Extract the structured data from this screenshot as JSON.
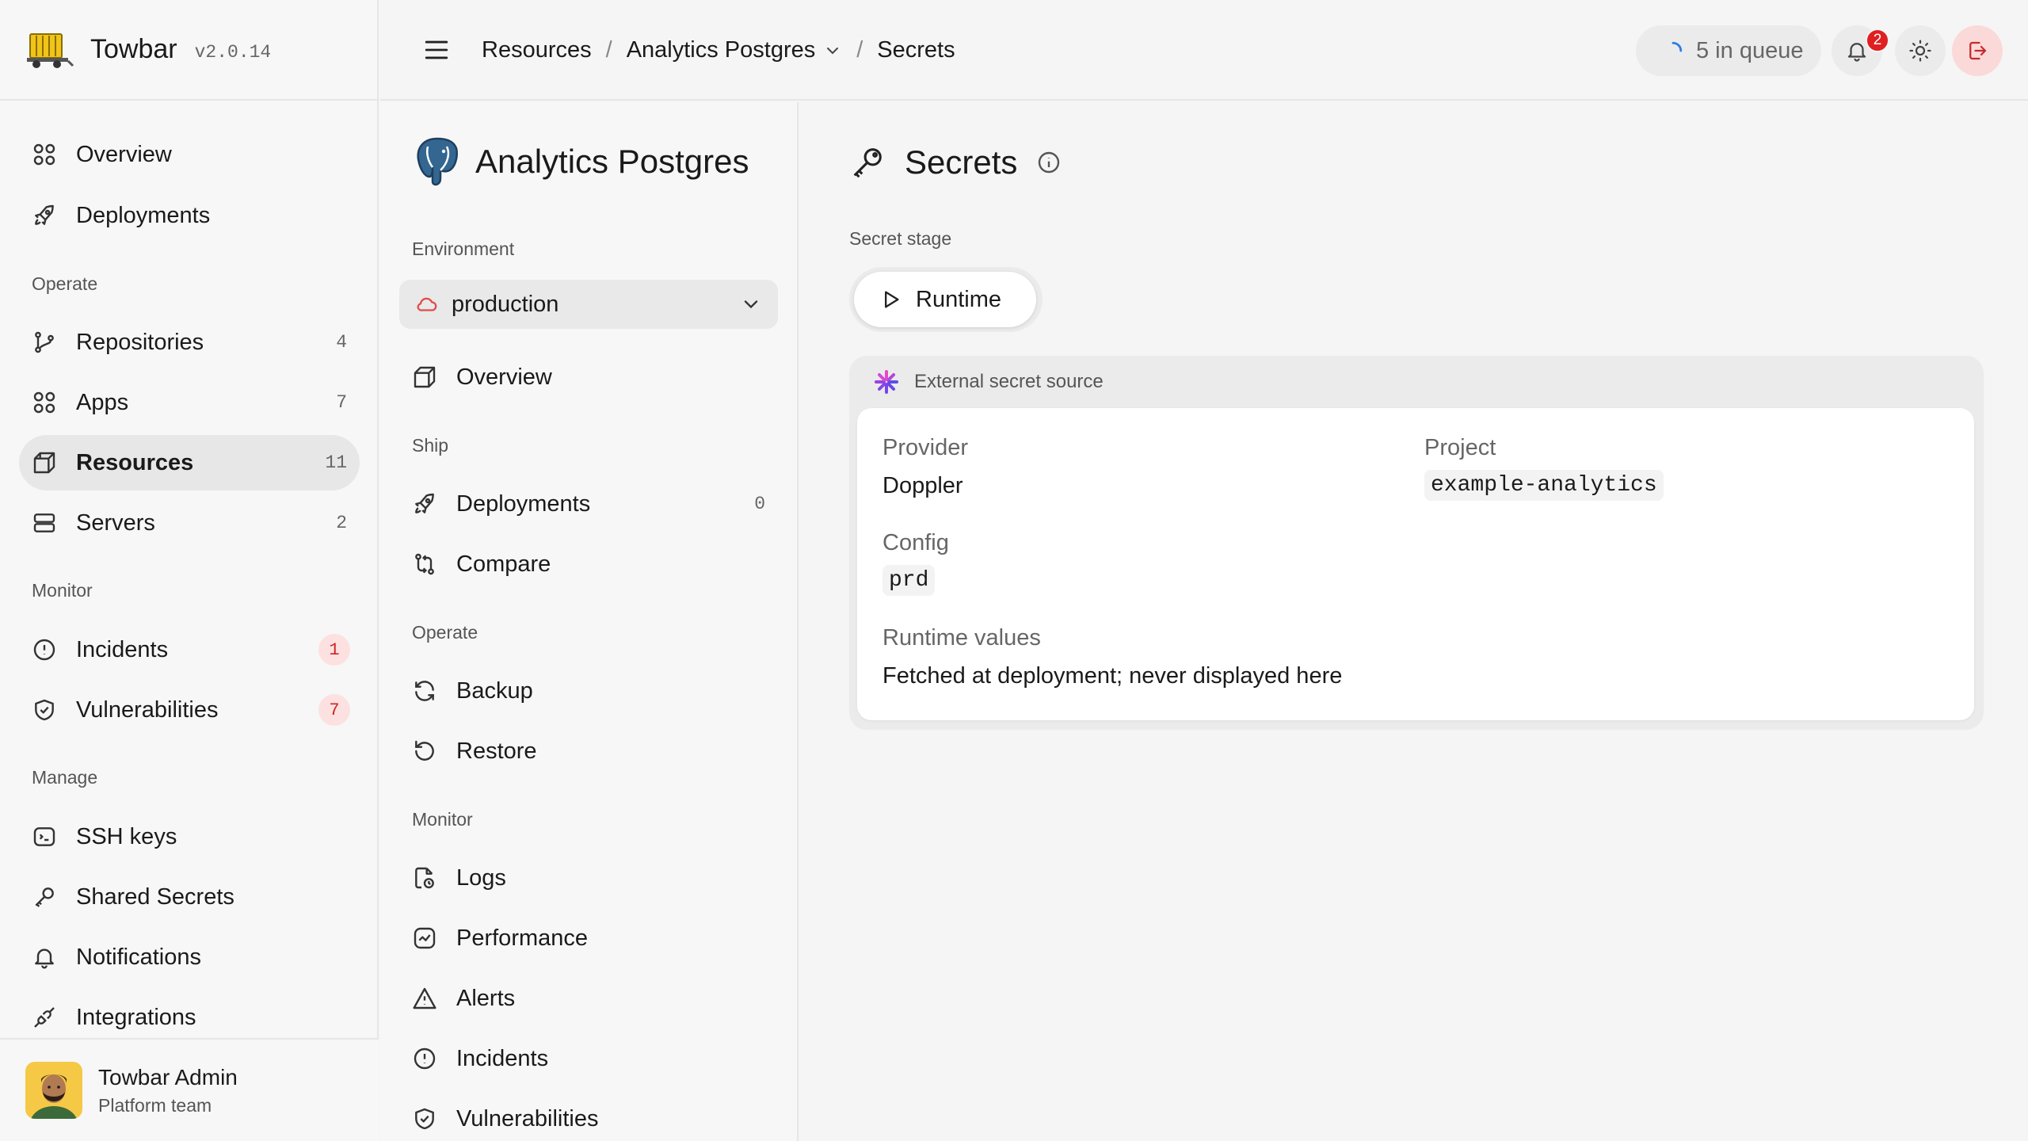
{
  "app": {
    "name": "Towbar",
    "version": "v2.0.14"
  },
  "sidebar": {
    "top_items": [
      {
        "label": "Overview",
        "icon": "grid-icon"
      },
      {
        "label": "Deployments",
        "icon": "rocket-icon"
      }
    ],
    "sections": {
      "operate": "Operate",
      "monitor": "Monitor",
      "manage": "Manage"
    },
    "operate_items": [
      {
        "label": "Repositories",
        "count": "4",
        "icon": "git-branch-icon"
      },
      {
        "label": "Apps",
        "count": "7",
        "icon": "grid-icon"
      },
      {
        "label": "Resources",
        "count": "11",
        "icon": "cube-icon",
        "active": true
      },
      {
        "label": "Servers",
        "count": "2",
        "icon": "server-icon"
      }
    ],
    "monitor_items": [
      {
        "label": "Incidents",
        "badge": "1",
        "icon": "alert-circle-icon"
      },
      {
        "label": "Vulnerabilities",
        "badge": "7",
        "icon": "shield-check-icon"
      }
    ],
    "manage_items": [
      {
        "label": "SSH keys",
        "icon": "terminal-icon"
      },
      {
        "label": "Shared Secrets",
        "icon": "key-icon"
      },
      {
        "label": "Notifications",
        "icon": "bell-icon"
      },
      {
        "label": "Integrations",
        "icon": "plug-icon"
      }
    ],
    "user": {
      "name": "Towbar Admin",
      "team": "Platform team"
    }
  },
  "topbar": {
    "breadcrumb": [
      "Resources",
      "Analytics Postgres",
      "Secrets"
    ],
    "breadcrumb_sep": "/",
    "queue": "5 in queue",
    "notifications_count": "2"
  },
  "resource": {
    "title": "Analytics Postgres",
    "environment_label": "Environment",
    "environment": "production",
    "overview": "Overview",
    "sections": {
      "ship": "Ship",
      "operate": "Operate",
      "monitor": "Monitor"
    },
    "ship_items": [
      {
        "label": "Deployments",
        "count": "0",
        "icon": "rocket-icon"
      },
      {
        "label": "Compare",
        "icon": "compare-icon"
      }
    ],
    "operate_items": [
      {
        "label": "Backup",
        "icon": "refresh-icon"
      },
      {
        "label": "Restore",
        "icon": "undo-icon"
      }
    ],
    "monitor_items": [
      {
        "label": "Logs",
        "icon": "file-clock-icon"
      },
      {
        "label": "Performance",
        "icon": "chart-line-icon"
      },
      {
        "label": "Alerts",
        "icon": "triangle-alert-icon"
      },
      {
        "label": "Incidents",
        "icon": "alert-circle-icon"
      },
      {
        "label": "Vulnerabilities",
        "icon": "shield-check-icon"
      }
    ]
  },
  "main": {
    "title": "Secrets",
    "stage_label": "Secret stage",
    "stage": "Runtime",
    "external": {
      "title": "External secret source",
      "provider_label": "Provider",
      "provider": "Doppler",
      "project_label": "Project",
      "project": "example-analytics",
      "config_label": "Config",
      "config": "prd",
      "runtime_label": "Runtime values",
      "runtime": "Fetched at deployment; never displayed here"
    }
  },
  "colors": {
    "accent_blue": "#2f7be6",
    "danger": "#e02020",
    "badge_bg": "#fde1e1",
    "postgres_blue": "#336791"
  }
}
